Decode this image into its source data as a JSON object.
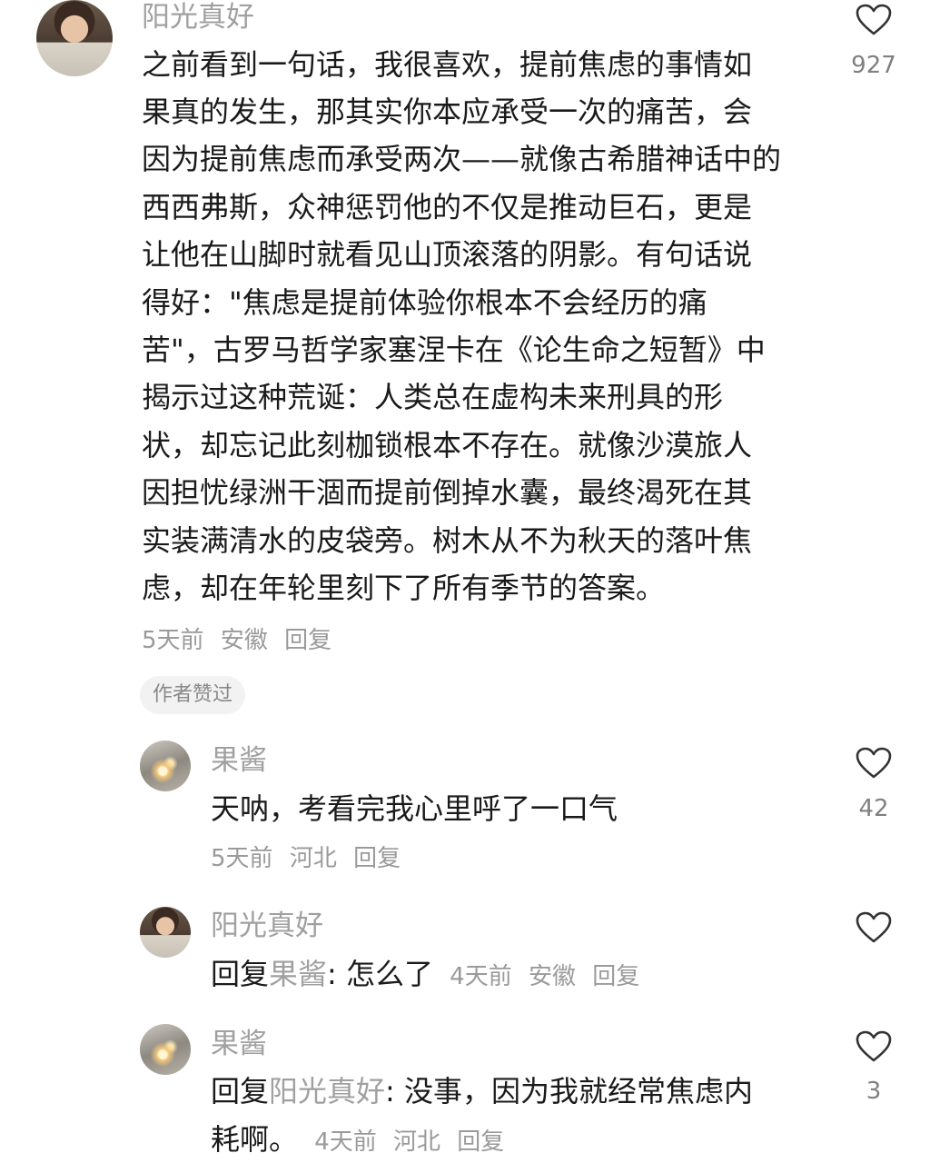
{
  "comment_main": {
    "username": "阳光真好",
    "lines": [
      "之前看到一句话，我很喜欢，提前焦虑的事情如",
      "果真的发生，那其实你本应承受一次的痛苦，会",
      "因为提前焦虑而承受两次——就像古希腊神话中的",
      "西西弗斯，众神惩罚他的不仅是推动巨石，更是",
      "让他在山脚时就看见山顶滚落的阴影。有句话说",
      "得好：\"焦虑是提前体验你根本不会经历的痛",
      "苦\"，古罗马哲学家塞涅卡在《论生命之短暂》中",
      "揭示过这种荒诞：人类总在虚构未来刑具的形",
      "状，却忘记此刻枷锁根本不存在。就像沙漠旅人",
      "因担忧绿洲干涸而提前倒掉水囊，最终渴死在其",
      "实装满清水的皮袋旁。树木从不为秋天的落叶焦",
      "虑，却在年轮里刻下了所有季节的答案。"
    ],
    "time": "5天前",
    "location": "安徽",
    "reply_label": "回复",
    "like_count": "927",
    "badge": "作者赞过"
  },
  "replies": [
    {
      "username": "果酱",
      "text": "天呐，考看完我心里呼了一口气",
      "time": "5天前",
      "location": "河北",
      "reply_label": "回复",
      "like_count": "42"
    },
    {
      "username": "阳光真好",
      "prefix": "回复",
      "reply_to": "果酱",
      "text": ": 怎么了",
      "time": "4天前",
      "location": "安徽",
      "reply_label": "回复",
      "like_count": ""
    },
    {
      "username": "果酱",
      "prefix": "回复",
      "reply_to": "阳光真好",
      "text": ": 没事，因为我就经常焦虑内",
      "text_line2": "耗啊。",
      "time": "4天前",
      "location": "河北",
      "reply_label": "回复",
      "like_count": "3"
    }
  ],
  "icons": {
    "like": "heart-outline-icon"
  }
}
